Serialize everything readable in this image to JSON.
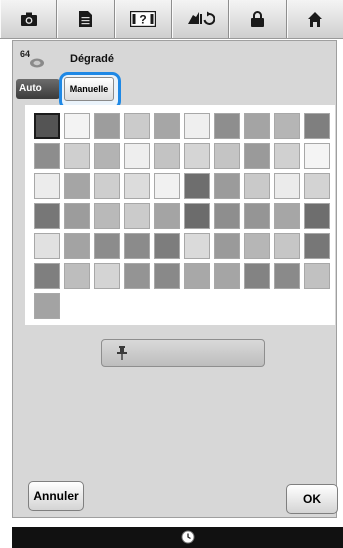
{
  "toolbar": {
    "buttons": [
      {
        "icon": "camera-icon"
      },
      {
        "icon": "document-icon"
      },
      {
        "icon": "help-icon",
        "label": "?"
      },
      {
        "icon": "thread-change-icon"
      },
      {
        "icon": "lock-icon"
      },
      {
        "icon": "home-icon"
      }
    ]
  },
  "header": {
    "number": "64",
    "title": "Dégradé"
  },
  "mode": {
    "auto_label": "Auto",
    "manual_label": "Manuelle",
    "selected": "manual"
  },
  "palette": {
    "selected_index": 0,
    "colors": [
      "#545454",
      "#f3f3f3",
      "#9d9d9d",
      "#cbcbcb",
      "#a6a6a6",
      "#efefef",
      "#8e8e8e",
      "#a4a4a4",
      "#b5b5b5",
      "#7f7f7f",
      "#8d8d8d",
      "#cfcfcf",
      "#b3b3b3",
      "#eeeeee",
      "#c3c3c3",
      "#d5d5d5",
      "#c4c4c4",
      "#9a9a9a",
      "#d0d0d0",
      "#f4f4f4",
      "#ececec",
      "#a5a5a5",
      "#cecece",
      "#dcdcdc",
      "#f1f1f1",
      "#6e6e6e",
      "#9b9b9b",
      "#c9c9c9",
      "#ebebeb",
      "#d3d3d3",
      "#777777",
      "#9c9c9c",
      "#b9b9b9",
      "#cbcbcb",
      "#a4a4a4",
      "#6c6c6c",
      "#8e8e8e",
      "#959595",
      "#a6a6a6",
      "#6e6e6e",
      "#e1e1e1",
      "#a3a3a3",
      "#8c8c8c",
      "#8b8b8b",
      "#7d7d7d",
      "#dadada",
      "#9a9a9a",
      "#b6b6b6",
      "#c6c6c6",
      "#777777",
      "#7f7f7f",
      "#bdbdbd",
      "#d4d4d4",
      "#949494",
      "#898989",
      "#a8a8a8",
      "#a5a5a5",
      "#838383",
      "#8a8a8a",
      "#c1c1c1",
      "#a3a3a3"
    ]
  },
  "footer_buttons": {
    "cancel_label": "Annuler",
    "ok_label": "OK"
  },
  "colors": {
    "accent": "#1e88e5",
    "panel": "#d7d7d7"
  }
}
